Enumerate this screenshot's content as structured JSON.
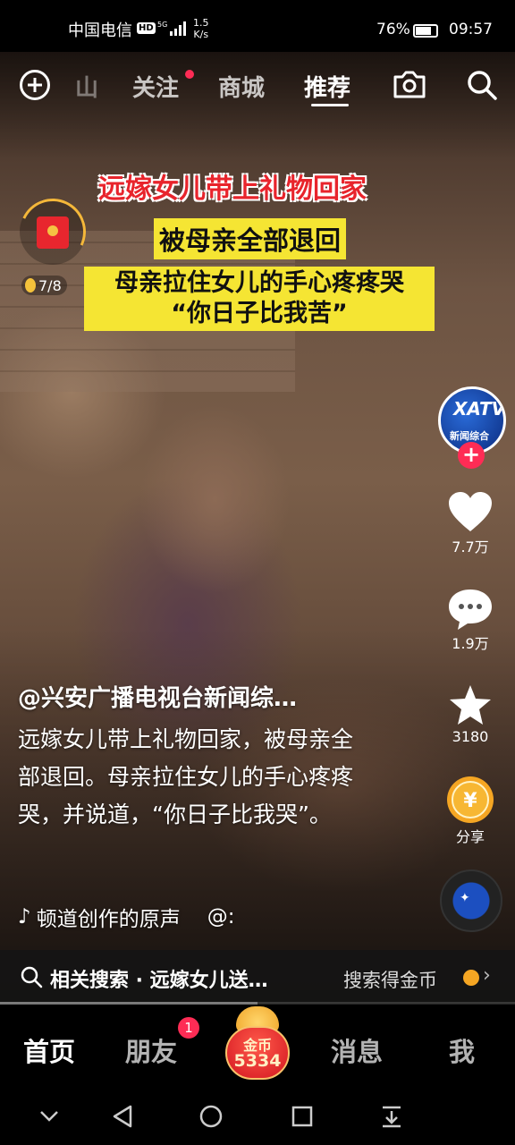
{
  "status": {
    "carrier": "中国电信",
    "hd": "HD",
    "net": "5G",
    "speed_value": "1.5",
    "speed_unit": "K/s",
    "battery": "76%",
    "time": "09:57"
  },
  "topnav": {
    "tabs": [
      "山",
      "关注",
      "商城",
      "推荐"
    ],
    "active_tab": "推荐"
  },
  "captions": {
    "line1": "远嫁女儿带上礼物回家",
    "line2": "被母亲全部退回",
    "line3": "母亲拉住女儿的手心疼疼哭",
    "line4": "“你日子比我苦”"
  },
  "packet": {
    "count": "7/8"
  },
  "avatar": {
    "logo": "XATV",
    "label": "新闻综合"
  },
  "rail": {
    "likes": "7.7万",
    "comments": "1.9万",
    "favorites": "3180",
    "share": "分享"
  },
  "post": {
    "author": "@兴安广播电视台新闻综…",
    "description": "远嫁女儿带上礼物回家，被母亲全部退回。母亲拉住女儿的手心疼疼哭，并说道，“你日子比我哭”。",
    "music": "顿道创作的原声",
    "music_at": "@:"
  },
  "related": {
    "label": "相关搜索 · 远嫁女儿送…",
    "earn": "搜索得金币",
    "chevron": "›"
  },
  "tabbar": {
    "home": "首页",
    "friends": "朋友",
    "friends_badge": "1",
    "coin_label": "金币",
    "coin_value": "5334",
    "messages": "消息",
    "me": "我"
  },
  "colors": {
    "accent_red": "#fe2c55",
    "caption_red": "#e8242c",
    "caption_yellow": "#f5e533",
    "gold": "#f5a623"
  }
}
